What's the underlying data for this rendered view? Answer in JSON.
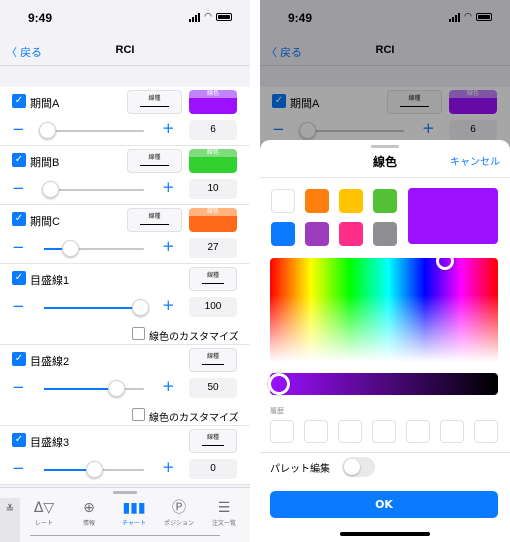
{
  "left": {
    "status": {
      "time": "9:49"
    },
    "nav": {
      "back": "〈 戻る",
      "title": "RCI"
    },
    "items": [
      {
        "label": "期間A",
        "line_caption": "線種",
        "color_caption": "線色",
        "color_band": "#c383ff",
        "color_fill": "#9c10ff",
        "value": "6",
        "slider_fraction": 0.03
      },
      {
        "label": "期間B",
        "line_caption": "線種",
        "color_caption": "線色",
        "color_band": "#7ddd7a",
        "color_fill": "#31d230",
        "value": "10",
        "slider_fraction": 0.06
      },
      {
        "label": "期間C",
        "line_caption": "線種",
        "color_caption": "線色",
        "color_band": "#ffb37d",
        "color_fill": "#ff6a1a",
        "value": "27",
        "slider_fraction": 0.26
      },
      {
        "label": "目盛線1",
        "line_caption": "線種",
        "value": "100",
        "slider_fraction": 0.96,
        "custom": "線色のカスタマイズ"
      },
      {
        "label": "目盛線2",
        "line_caption": "線種",
        "value": "50",
        "slider_fraction": 0.72,
        "custom": "線色のカスタマイズ"
      },
      {
        "label": "目盛線3",
        "line_caption": "線種",
        "value": "0",
        "slider_fraction": 0.5
      }
    ],
    "tabs": [
      {
        "name": "tab-rate",
        "icon": "Δ▽",
        "label": "レート",
        "active": false
      },
      {
        "name": "tab-info",
        "icon": "⊕",
        "label": "情報",
        "active": false
      },
      {
        "name": "tab-chart",
        "icon": "▮▮▮",
        "label": "チャート",
        "active": true
      },
      {
        "name": "tab-position",
        "icon": "Ⓟ",
        "label": "ポジション",
        "active": false
      },
      {
        "name": "tab-orders",
        "icon": "☰",
        "label": "注文一覧",
        "active": false
      }
    ],
    "collapse_icon": "≚"
  },
  "right": {
    "status": {
      "time": "9:49"
    },
    "nav": {
      "back": "〈 戻る",
      "title": "RCI"
    },
    "bg_item": {
      "label": "期間A",
      "line_caption": "線種",
      "color_caption": "線色",
      "value": "6"
    },
    "sheet": {
      "title": "線色",
      "cancel": "キャンセル",
      "swatches": [
        "#ffffff",
        "#ff7f0e",
        "#ffc300",
        "#52c234",
        "#0a7aff",
        "#9d3bbd",
        "#ff2f87",
        "#8e8e93"
      ],
      "selected_color": "#9c10ff",
      "history_label": "履歴",
      "history_slots": 7,
      "palette_edit": "パレット編集",
      "palette_toggle_on": false,
      "ok": "OK"
    }
  }
}
